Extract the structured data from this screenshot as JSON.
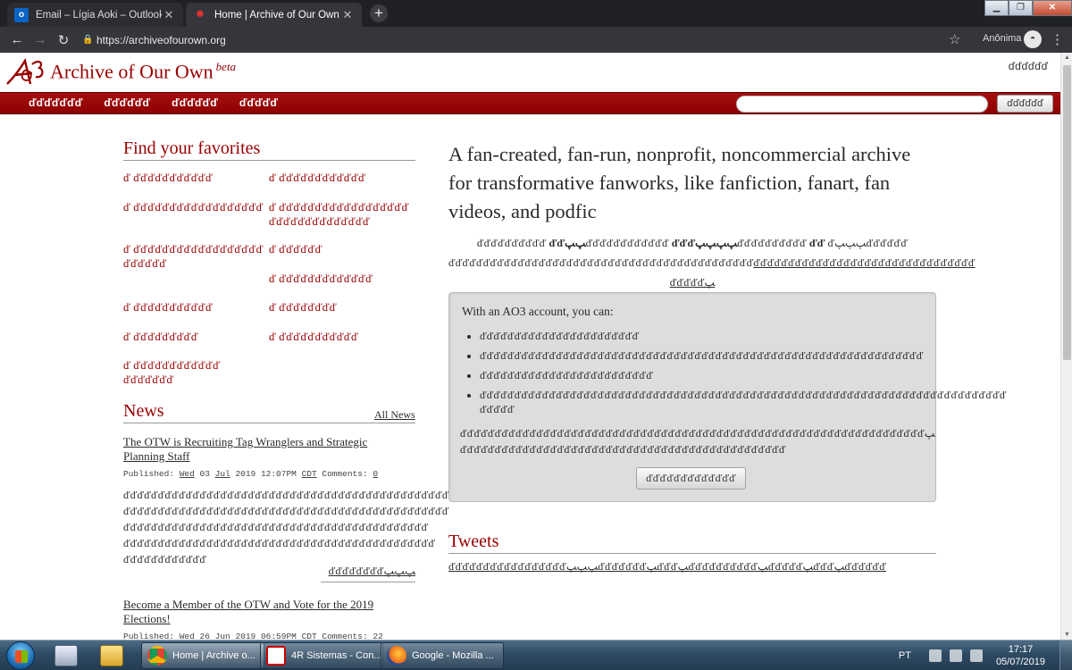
{
  "browser": {
    "tabs": [
      {
        "label": "Email – Lígia Aoki – Outlook",
        "icon": "outlook-icon"
      },
      {
        "label": "Home | Archive of Our Own",
        "icon": "ao3-icon"
      }
    ],
    "url": "https://archiveofourown.org",
    "profile_label": "Anônima",
    "icons": [
      "back-arrow-icon",
      "forward-arrow-icon",
      "reload-icon",
      "lock-icon",
      "star-icon",
      "incognito-icon",
      "menu-icon"
    ]
  },
  "site": {
    "name": "Archive of Our Own",
    "beta": "beta",
    "login_link": "ďďďďďď",
    "accent_color": "#990000",
    "nav": [
      "ďďďďďďď",
      "ďďďďďď",
      "ďďďďďď",
      "ďďďďď"
    ],
    "search_button": "ďďďďďď"
  },
  "favorites": {
    "heading": "Find your favorites",
    "items": [
      {
        "l1": "ď ďďďďďďďďďďď",
        "l2": ""
      },
      {
        "l1": "ď ďďďďďďďďďďďď",
        "l2": ""
      },
      {
        "l1": "ď ďďďďďďďďďďďďďďďďďď",
        "l2": ""
      },
      {
        "l1": "ď ďďďďďďďďďďďďďďďďďď",
        "l2": "ďďďďďďďďďďďďďď"
      },
      {
        "l1": "ď ďďďďďďďďďďďďďďďďďď",
        "l2": "ďďďďďď"
      },
      {
        "l1": "ď ďďďďďď",
        "l2": ""
      },
      {
        "l1": "ď ďďďďďďďďďďďďď",
        "l2": ""
      },
      {
        "l1": "ď ďďďďďďďďďďď",
        "l2": ""
      },
      {
        "l1": "ď ďďďďďďďď",
        "l2": ""
      },
      {
        "l1": "ď ďďďďďďďďď",
        "l2": ""
      },
      {
        "l1": "ď ďďďďďďďďďďď",
        "l2": ""
      },
      {
        "l1": "ď ďďďďďďďďďďďď",
        "l2": "ďďďďďďď"
      }
    ]
  },
  "news": {
    "heading": "News",
    "all_news": "All News",
    "posts": [
      {
        "title_l1": "The OTW is Recruiting Tag Wranglers and Strategic",
        "title_l2": "Planning Staff",
        "meta_published": "Published:",
        "meta_day": "Wed",
        "meta_date1": "03",
        "meta_month": "Jul",
        "meta_rest": "2019 12:07PM",
        "meta_tz": "CDT",
        "meta_comments": "Comments:",
        "meta_count": "0",
        "body": [
          "ďďďďďďďďďďďďďďďďďďďďďďďďďďďďďďďďďďďďďďďďďďďďďďďď",
          "ďďďďďďďďďďďďďďďďďďďďďďďďďďďďďďďďďďďďďďďďďďďďďďď",
          "ďďďďďďďďďďďďďďďďďďďďďďďďďďďďďďďďďďďďďďďďďďďď",
          "ďďďďďďďďďďďďďďďďďďďďďďďďďďďďďďďďďďďďďďďďďďďďď",
          "ďďďďďďďďďďďď"
        ],
        "read_more": "ďďďďďďďďﭗﭗﭗ"
      },
      {
        "title_l1": "Become a Member of the OTW and Vote for the 2019",
        "title_l2": "Elections!",
        "meta_published": "Published:",
        "meta_day": "Wed",
        "meta_date1": "26",
        "meta_month": "Jun",
        "meta_rest": "2019 06:59PM",
        "meta_tz": "CDT",
        "meta_comments": "Comments:",
        "meta_count": "22"
      }
    ]
  },
  "intro": {
    "headline": "A fan-created, fan-run, nonprofit, noncommercial archive for transformative fanworks, like fanfiction, fanart, fan videos, and podfic",
    "sub_line1_a": "ďďďďďďďďďď ",
    "sub_line1_b": "ďďﭗﭗ",
    "sub_line1_c": "ďďďďďďďďďďďď ",
    "sub_line1_d": "ďďďﭗﭗﭗﭗ",
    "sub_line1_e": "ďďďďďďďďďď ",
    "sub_line1_f": "ďď",
    "sub_line1_g": "  ďﭗﭗﭗďďďďďď",
    "sub_line2_a": "ďďďďďďďďďďďďďďďďďďďďďďďďďďďďďďďďďďďďďďďďďďďď",
    "sub_line2_b": "ďďďďďďďďďďďďďďďďďďďďďďďďďďďďďďďď",
    "sub_line3": "ďďďďďﭗ"
  },
  "account": {
    "heading": "With an AO3 account, you can:",
    "items": [
      "ďďďďďďďďďďďďďďďďďďďďďďď",
      "ďďďďďďďďďďďďďďďďďďďďďďďďďďďďďďďďďďďďďďďďďďďďďďďďďďďďďďďďďďďďďďďď",
      "ďďďďďďďďďďďďďďďďďďďďďďďďď",
      "ďďďďďďďďďďďďďďďďďďďďďďďďďďďďďďďďďďďďďďďďďďďďďďďďďďďďďďďďďďďďďďďďďďďďďďďďďďďď ďďďďď"
    ],
    "note": "ďďďďďďďďďďďďďďďďďďďďďďďďďďďďďďďďďďďďďďďďďďďďďďďďďďďďďďďďďďďďďďďďďďďﭗ ďďďďďďďďďďďďďďďďďďďďďďďďďďďďďďďďďďďďďďďďďďďďďďď",
    "button": "ďďďďďďďďďďďďď"
  },
  "tweets": {
    "heading": "Tweets",
    "link": "ďďďďďďďďďďďďďďďďďﭗﭗﭗďďďďďďďﭗďďďﭗďďďďďďďďďďﭗďďďďďﭗďďďﭗďďďďďď"
  },
  "taskbar": {
    "buttons": [
      {
        "label": "Home | Archive o...",
        "icon": "chrome-icon"
      },
      {
        "label": "4R Sistemas - Con...",
        "icon": "app-4r-icon"
      },
      {
        "label": "Google - Mozilla ...",
        "icon": "firefox-icon"
      }
    ],
    "lang": "PT",
    "time": "17:17",
    "date": "05/07/2019"
  }
}
